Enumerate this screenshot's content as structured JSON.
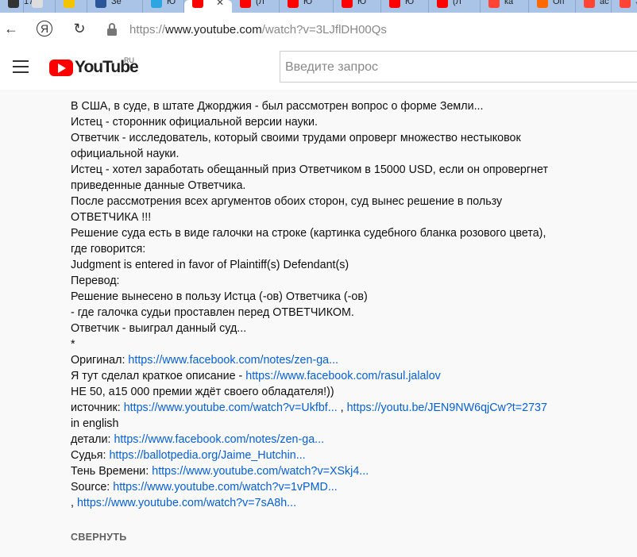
{
  "tabs": [
    {
      "label": "17",
      "color": "#333333"
    },
    {
      "label": "",
      "color": "#dddddd"
    },
    {
      "label": "",
      "color": "#f5c400"
    },
    {
      "label": "Зе",
      "color": "#2a5699"
    },
    {
      "label": "Ю",
      "color": "#2ca5e0"
    },
    {
      "label": "",
      "color": "#ff0000",
      "active": true,
      "close": "✕"
    },
    {
      "label": "(Л",
      "color": "#ff0000"
    },
    {
      "label": "Ю",
      "color": "#ff0000"
    },
    {
      "label": "Ю",
      "color": "#ff0000"
    },
    {
      "label": "Ю",
      "color": "#ff0000"
    },
    {
      "label": "(Л",
      "color": "#ff0000"
    },
    {
      "label": "ка",
      "color": "#ff4433"
    },
    {
      "label": "Оп",
      "color": "#ff6a00"
    },
    {
      "label": "ас",
      "color": "#ff4433"
    },
    {
      "label": "ЭЙ",
      "color": "#ff4433"
    }
  ],
  "addressbar": {
    "back": "←",
    "yandex": "Я",
    "reload": "↻",
    "url_proto": "https://",
    "url_host": "www.youtube.com",
    "url_path": "/watch?v=3LJflDH00Qs"
  },
  "header": {
    "logo_text": "YouTube",
    "logo_region": "RU",
    "search_placeholder": "Введите запрос"
  },
  "description": [
    [
      {
        "t": "В США, в суде, в штате Джорджия - был рассмотрен вопрос о форме Земли..."
      }
    ],
    [
      {
        "t": "Истец - сторонник официальной версии науки."
      }
    ],
    [
      {
        "t": "Ответчик - исследователь, который своими трудами опроверг множество нестыковок"
      }
    ],
    [
      {
        "t": "официальной науки."
      }
    ],
    [
      {
        "t": "Истец - хотел заработать обещанный приз Ответчиком в 15000 USD, если он опровергнет"
      }
    ],
    [
      {
        "t": "приведенные данные Ответчика."
      }
    ],
    [
      {
        "t": "После рассмотрения всех аргументов обоих сторон, суд вынес решение в пользу"
      }
    ],
    [
      {
        "t": "ОТВЕТЧИКА !!!"
      }
    ],
    [
      {
        "t": "Решение суда есть в виде галочки на строке (картинка судебного бланка розового цвета),"
      }
    ],
    [
      {
        "t": "где говорится:"
      }
    ],
    [
      {
        "t": "Judgment is entered in favor of Plaintiff(s) Defendant(s)"
      }
    ],
    [
      {
        "t": "Перевод:"
      }
    ],
    [
      {
        "t": "Решение вынесено в пользу Истца (-ов) Ответчика (-ов)"
      }
    ],
    [
      {
        "t": "- где галочка судьи проставлен перед ОТВЕТЧИКОМ."
      }
    ],
    [
      {
        "t": "Ответчик - выиграл данный суд..."
      }
    ],
    [
      {
        "t": "*"
      }
    ],
    [
      {
        "t": "Оригинал: "
      },
      {
        "t": "https://www.facebook.com/notes/zen-ga...",
        "link": true
      }
    ],
    [
      {
        "t": "Я тут сделал краткое описание - "
      },
      {
        "t": "https://www.facebook.com/rasul.jalalov",
        "link": true
      }
    ],
    [
      {
        "t": "НЕ 50, а15 000 премии ждёт своего обладателя!))"
      }
    ],
    [
      {
        "t": "источник: "
      },
      {
        "t": "https://www.youtube.com/watch?v=Ukfbf...",
        "link": true
      },
      {
        "t": "  ,  "
      },
      {
        "t": "https://youtu.be/JEN9NW6qjCw?t=2737",
        "link": true
      }
    ],
    [
      {
        "t": "in english"
      }
    ],
    [
      {
        "t": "детали: "
      },
      {
        "t": "https://www.facebook.com/notes/zen-ga...",
        "link": true
      }
    ],
    [
      {
        "t": "Судья: "
      },
      {
        "t": "https://ballotpedia.org/Jaime_Hutchin...",
        "link": true
      }
    ],
    [
      {
        "t": "Тень Времени: "
      },
      {
        "t": "https://www.youtube.com/watch?v=XSkj4...",
        "link": true
      }
    ],
    [
      {
        "t": "Source: "
      },
      {
        "t": "https://www.youtube.com/watch?v=1vPMD...",
        "link": true
      }
    ],
    [
      {
        "t": ", "
      },
      {
        "t": "https://www.youtube.com/watch?v=7sA8h...",
        "link": true
      }
    ]
  ],
  "collapse_label": "СВЕРНУТЬ"
}
